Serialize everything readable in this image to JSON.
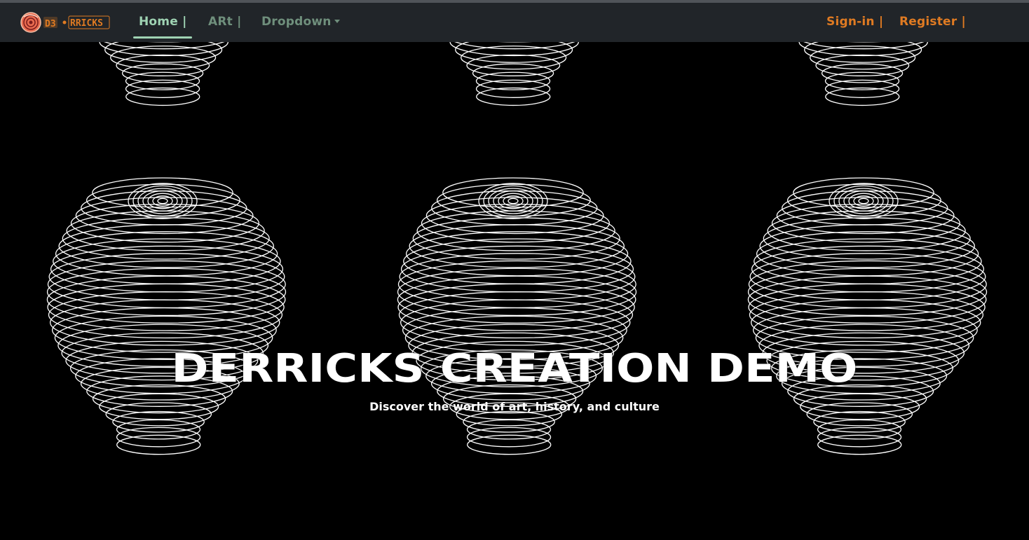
{
  "navbar": {
    "brand": {
      "logo_text_left": "D3",
      "logo_text_right": "RRICKS",
      "logo_icon": "brain-swirl-icon"
    },
    "links": {
      "home": "Home |",
      "art": "ARt |",
      "dropdown": "Dropdown",
      "dropdown_icon": "caret-down-icon",
      "signin": "Sign-in |",
      "register": "Register |"
    }
  },
  "hero": {
    "title": "DERRICKS CREATION DEMO",
    "subtitle": "Discover the world of art, history, and culture",
    "background_motif": "white contour-line 3D vase shapes on black"
  },
  "colors": {
    "navbar_bg": "#212529",
    "active_link": "#9fd3b3",
    "inactive_link": "#6f8f7c",
    "auth_link": "#e07b22",
    "hero_bg": "#000000",
    "hero_text": "#ffffff"
  }
}
